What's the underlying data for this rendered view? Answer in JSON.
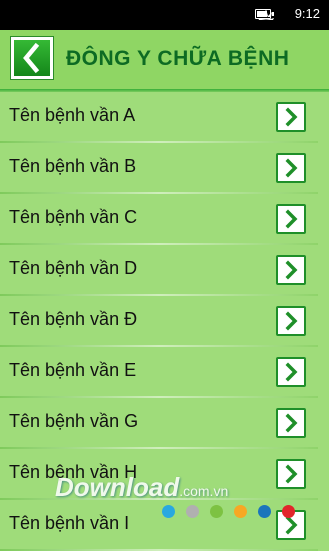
{
  "status_bar": {
    "time": "9:12",
    "icons": [
      "flower-icon",
      "battery-icon"
    ]
  },
  "header": {
    "title": "ĐÔNG Y CHỮA BỆNH",
    "back_icon": "chevron-left-icon"
  },
  "list": {
    "items": [
      {
        "label": "Tên bệnh vần A"
      },
      {
        "label": "Tên bệnh vần B"
      },
      {
        "label": "Tên bệnh vần C"
      },
      {
        "label": "Tên bệnh vần D"
      },
      {
        "label": "Tên bệnh vần Đ"
      },
      {
        "label": "Tên bệnh vần E"
      },
      {
        "label": "Tên bệnh vần G"
      },
      {
        "label": "Tên bệnh vần H"
      },
      {
        "label": "Tên bệnh vần I"
      }
    ],
    "item_icon": "chevron-right-icon"
  },
  "watermark": {
    "brand": "Download",
    "suffix": ".com.vn",
    "dot_colors": [
      "#29a8e0",
      "#b0b0b0",
      "#7dc242",
      "#f7a823",
      "#1b75bb",
      "#e2262b"
    ]
  },
  "colors": {
    "background": "#9fdc7a",
    "accent": "#0d6b23",
    "button_green": "#1f8f29"
  }
}
